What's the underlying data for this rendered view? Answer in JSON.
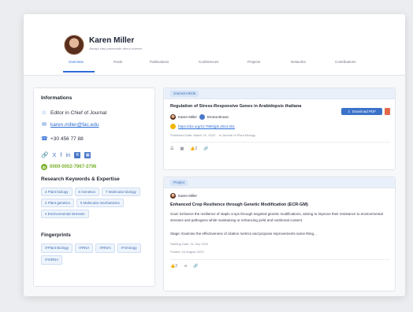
{
  "profile": {
    "name": "Karen Miller",
    "tagline": "Always stay passionate about science."
  },
  "tabs": [
    {
      "label": "Overview",
      "active": true
    },
    {
      "label": "Posts",
      "active": false
    },
    {
      "label": "Publications",
      "active": false
    },
    {
      "label": "Conferences",
      "active": false
    },
    {
      "label": "Projects",
      "active": false
    },
    {
      "label": "Networks",
      "active": false
    },
    {
      "label": "Contributions",
      "active": false
    }
  ],
  "info": {
    "title": "Informations",
    "role": "Editor in Chief of Journal",
    "email": "karen.miller@fac.edu",
    "phone": "+30 456 77 88",
    "orcid": "0000-0002-7967-3796",
    "socials": {
      "share": "share-icon",
      "x": "X",
      "facebook": "f",
      "linkedin": "in"
    }
  },
  "keywords": {
    "title": "Research Keywords & Expertise",
    "items": [
      "4 Plant biology",
      "6 Genetics",
      "7 Molecular biology",
      "4 Plant genetics",
      "5 Molecular mechanisms",
      "4 Environmental stresses"
    ]
  },
  "fingerprints": {
    "title": "Fingerprints",
    "items": [
      "Plant Biology",
      "RNA",
      "RNAi",
      "Virology",
      "SiRNA"
    ]
  },
  "article": {
    "type": "Journal Article",
    "title": "Regulation of Stress-Responsive Genes in Arabidopsis thaliana",
    "authors": [
      "Karen Miller",
      "Emma Brown"
    ],
    "doi": "https://doi.org/10.7890/jpb.2024.001",
    "published": "Published Date: March 10, 2022",
    "journal": "In Journal of Plant Biology",
    "download_label": "Download PDF",
    "likes": "2"
  },
  "project": {
    "type": "Project",
    "author": "Karen Miller",
    "title": "Enhanced Crop Resilience through Genetic Modification (ECR-GM)",
    "goal": "Goal: Enhance the resilience of staple crops through targeted genetic modifications, aiming to improve their resistance to environmental stresses and pathogens while maintaining or enhancing yield and nutritional content.",
    "stage": "Stage: Examine the effectiveness of citation metrics and propose improvements same thing...",
    "starting": "Starting Date: 01 July 2020",
    "posted": "Posted: 24 August 2023",
    "likes": "2"
  },
  "colors": {
    "accent": "#2e6fd6",
    "orcid": "#7bb22e",
    "header_band": "#e9f0fa"
  }
}
